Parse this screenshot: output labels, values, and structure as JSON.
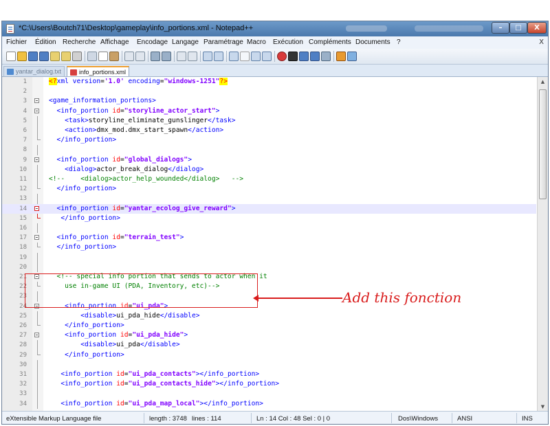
{
  "window": {
    "title": "*C:\\Users\\Boutch71\\Desktop\\gameplay\\info_portions.xml - Notepad++",
    "minimize": "–",
    "maximize": "□",
    "close": "X"
  },
  "menu": {
    "items": [
      "Fichier",
      "Édition",
      "Recherche",
      "Affichage",
      "Encodage",
      "Langage",
      "Paramétrage",
      "Macro",
      "Exécution",
      "Compléments",
      "Documents",
      "?"
    ],
    "close_doc": "X"
  },
  "toolbar": {
    "icons": [
      "new-file-icon",
      "open-file-icon",
      "save-icon",
      "save-all-icon",
      "close-icon",
      "close-all-icon",
      "print-icon",
      "cut-icon",
      "copy-icon",
      "paste-icon",
      "undo-icon",
      "redo-icon",
      "find-icon",
      "replace-icon",
      "zoom-in-icon",
      "zoom-out-icon",
      "sync-v-icon",
      "sync-h-icon",
      "word-wrap-icon",
      "show-all-chars-icon",
      "indent-guide-icon",
      "record-macro-icon",
      "stop-macro-icon",
      "play-macro-icon",
      "run-macro-multiple-icon",
      "save-macro-icon",
      "launch-browser-icon",
      "spell-check-icon"
    ]
  },
  "tabs": [
    {
      "label": "yantar_dialog.txt",
      "active": false
    },
    {
      "label": "info_portions.xml",
      "active": true
    }
  ],
  "editor": {
    "current_line": 14,
    "lines": [
      {
        "n": "1",
        "fold": "",
        "parts": [
          [
            "pi",
            "<?"
          ],
          [
            "tag",
            "xml version"
          ],
          [
            "txt",
            "="
          ],
          [
            "val",
            "'1.0'"
          ],
          [
            "tag",
            " encoding"
          ],
          [
            "txt",
            "="
          ],
          [
            "val",
            "\"windows-1251\""
          ],
          [
            "pi",
            "?>"
          ]
        ]
      },
      {
        "n": "2",
        "fold": "",
        "parts": []
      },
      {
        "n": "3",
        "fold": "open",
        "parts": [
          [
            "tag",
            "<game_information_portions>"
          ]
        ]
      },
      {
        "n": "4",
        "fold": "open",
        "parts": [
          [
            "tag",
            "  <info_portion "
          ],
          [
            "attr",
            "id"
          ],
          [
            "txt",
            "="
          ],
          [
            "val",
            "\"storyline_actor_start\""
          ],
          [
            "tag",
            ">"
          ]
        ]
      },
      {
        "n": "5",
        "fold": "line",
        "parts": [
          [
            "tag",
            "    <task>"
          ],
          [
            "txt",
            "storyline_eliminate_gunslinger"
          ],
          [
            "tag",
            "</task>"
          ]
        ]
      },
      {
        "n": "6",
        "fold": "line",
        "parts": [
          [
            "tag",
            "    <action>"
          ],
          [
            "txt",
            "dmx_mod.dmx_start_spawn"
          ],
          [
            "tag",
            "</action>"
          ]
        ]
      },
      {
        "n": "7",
        "fold": "end",
        "parts": [
          [
            "tag",
            "  </info_portion>"
          ]
        ]
      },
      {
        "n": "8",
        "fold": "line",
        "parts": []
      },
      {
        "n": "9",
        "fold": "open",
        "parts": [
          [
            "tag",
            "  <info_portion "
          ],
          [
            "attr",
            "id"
          ],
          [
            "txt",
            "="
          ],
          [
            "val",
            "\"global_dialogs\""
          ],
          [
            "tag",
            ">"
          ]
        ]
      },
      {
        "n": "10",
        "fold": "line",
        "parts": [
          [
            "tag",
            "    <dialog>"
          ],
          [
            "txt",
            "actor_break_dialog"
          ],
          [
            "tag",
            "</dialog>"
          ]
        ]
      },
      {
        "n": "11",
        "fold": "line",
        "parts": [
          [
            "com",
            "<!--    <dialog>actor_help_wounded</dialog>   -->"
          ]
        ]
      },
      {
        "n": "12",
        "fold": "end",
        "parts": [
          [
            "tag",
            "  </info_portion>"
          ]
        ]
      },
      {
        "n": "13",
        "fold": "line",
        "parts": []
      },
      {
        "n": "14",
        "fold": "open-red",
        "parts": [
          [
            "tag",
            "  <info_portion "
          ],
          [
            "attr",
            "id"
          ],
          [
            "txt",
            "="
          ],
          [
            "val",
            "\"yantar_ecolog_give_reward\""
          ],
          [
            "tag",
            ">"
          ]
        ]
      },
      {
        "n": "15",
        "fold": "end-red",
        "parts": [
          [
            "tag",
            "   </info_portion>"
          ]
        ]
      },
      {
        "n": "16",
        "fold": "line",
        "parts": []
      },
      {
        "n": "17",
        "fold": "open",
        "parts": [
          [
            "tag",
            "  <info_portion "
          ],
          [
            "attr",
            "id"
          ],
          [
            "txt",
            "="
          ],
          [
            "val",
            "\"terrain_test\""
          ],
          [
            "tag",
            ">"
          ]
        ]
      },
      {
        "n": "18",
        "fold": "end",
        "parts": [
          [
            "tag",
            "  </info_portion>"
          ]
        ]
      },
      {
        "n": "19",
        "fold": "line",
        "parts": []
      },
      {
        "n": "20",
        "fold": "line",
        "parts": []
      },
      {
        "n": "21",
        "fold": "open",
        "parts": [
          [
            "com",
            "  <!-- special info portion that sends to actor when it"
          ]
        ]
      },
      {
        "n": "22",
        "fold": "end",
        "parts": [
          [
            "com",
            "    use in-game UI (PDA, Inventory, etc)-->"
          ]
        ]
      },
      {
        "n": "23",
        "fold": "line",
        "parts": []
      },
      {
        "n": "24",
        "fold": "open",
        "parts": [
          [
            "tag",
            "    <info_portion "
          ],
          [
            "attr",
            "id"
          ],
          [
            "txt",
            "="
          ],
          [
            "val",
            "\"ui_pda\""
          ],
          [
            "tag",
            ">"
          ]
        ]
      },
      {
        "n": "25",
        "fold": "line",
        "parts": [
          [
            "tag",
            "        <disable>"
          ],
          [
            "txt",
            "ui_pda_hide"
          ],
          [
            "tag",
            "</disable>"
          ]
        ]
      },
      {
        "n": "26",
        "fold": "end",
        "parts": [
          [
            "tag",
            "    </info_portion>"
          ]
        ]
      },
      {
        "n": "27",
        "fold": "open",
        "parts": [
          [
            "tag",
            "    <info_portion "
          ],
          [
            "attr",
            "id"
          ],
          [
            "txt",
            "="
          ],
          [
            "val",
            "\"ui_pda_hide\""
          ],
          [
            "tag",
            ">"
          ]
        ]
      },
      {
        "n": "28",
        "fold": "line",
        "parts": [
          [
            "tag",
            "        <disable>"
          ],
          [
            "txt",
            "ui_pda"
          ],
          [
            "tag",
            "</disable>"
          ]
        ]
      },
      {
        "n": "29",
        "fold": "end",
        "parts": [
          [
            "tag",
            "    </info_portion>"
          ]
        ]
      },
      {
        "n": "30",
        "fold": "line",
        "parts": []
      },
      {
        "n": "31",
        "fold": "line",
        "parts": [
          [
            "tag",
            "   <info_portion "
          ],
          [
            "attr",
            "id"
          ],
          [
            "txt",
            "="
          ],
          [
            "val",
            "\"ui_pda_contacts\""
          ],
          [
            "tag",
            "></info_portion>"
          ]
        ]
      },
      {
        "n": "32",
        "fold": "line",
        "parts": [
          [
            "tag",
            "   <info_portion "
          ],
          [
            "attr",
            "id"
          ],
          [
            "txt",
            "="
          ],
          [
            "val",
            "\"ui_pda_contacts_hide\""
          ],
          [
            "tag",
            "></info_portion>"
          ]
        ]
      },
      {
        "n": "33",
        "fold": "line",
        "parts": []
      },
      {
        "n": "34",
        "fold": "line",
        "parts": [
          [
            "tag",
            "   <info_portion "
          ],
          [
            "attr",
            "id"
          ],
          [
            "txt",
            "="
          ],
          [
            "val",
            "\"ui_pda_map_local\""
          ],
          [
            "tag",
            "></info_portion>"
          ]
        ]
      }
    ]
  },
  "annotation": {
    "text": "Add this fonction",
    "color": "#d91c1c"
  },
  "statusbar": {
    "file_type": "eXtensible Markup Language file",
    "length": "length : 3748",
    "lines": "lines : 114",
    "position": "Ln : 14   Col : 48   Sel : 0 | 0",
    "eol": "Dos\\Windows",
    "encoding": "ANSI",
    "mode": "INS"
  }
}
